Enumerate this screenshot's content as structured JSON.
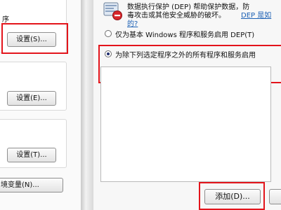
{
  "left": {
    "top_label": "序",
    "settings_button_1": "设置(S)...",
    "settings_button_2": "设置(E)...",
    "settings_button_3": "设置(T)...",
    "env_button": "境变量(N)..."
  },
  "dep": {
    "desc_line1": "数据执行保护 (DEP) 帮助保护数据，防",
    "desc_line2": "毒攻击或其他安全威胁的破坏。",
    "desc_link1": "DEP 是如",
    "desc_link2": "的?",
    "option_essential": "仅为基本 Windows 程序和服务启用 DEP(T)",
    "option_all_except": "为除下列选定程序之外的所有程序和服务启用",
    "option_all_selected": true,
    "add_button": "添加(D)..."
  },
  "colors": {
    "highlight_red": "#e3141b",
    "link_blue": "#1a5fb4"
  }
}
